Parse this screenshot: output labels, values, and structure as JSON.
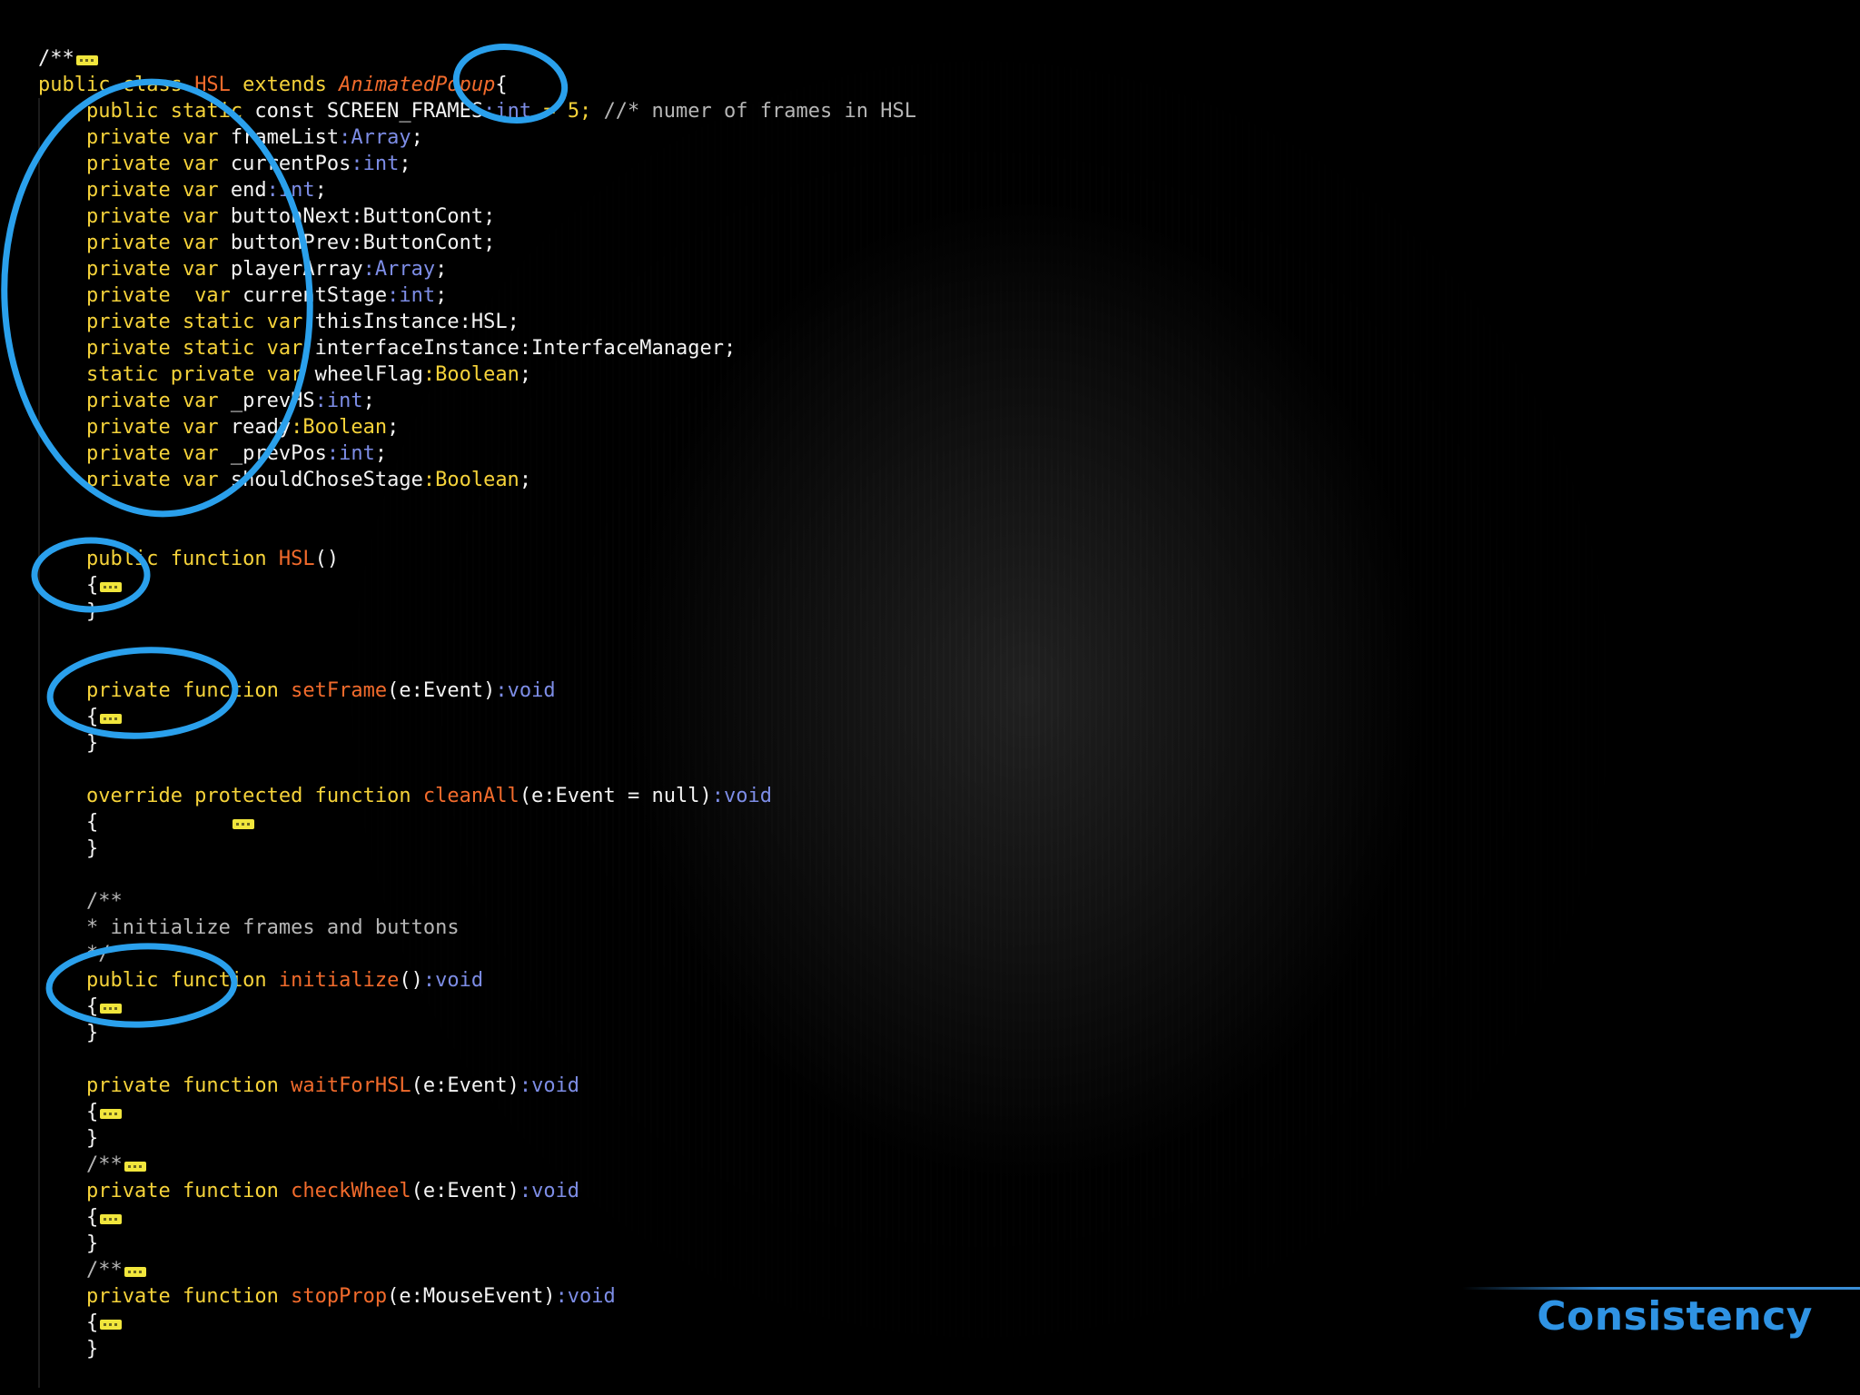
{
  "slide": {
    "title": "Consistency",
    "accent_color": "#2aa0ec"
  },
  "editor": {
    "language": "ActionScript",
    "fold_marker_icon": "collapsed-code-icon",
    "lines": [
      [
        {
          "t": "/**",
          "c": "txt"
        },
        {
          "fold": true
        }
      ],
      [
        {
          "t": "public class ",
          "c": "kw"
        },
        {
          "t": "HSL",
          "c": "cls"
        },
        {
          "t": " extends ",
          "c": "kw"
        },
        {
          "t": "AnimatedPopup",
          "c": "it"
        },
        {
          "t": "{",
          "c": "txt"
        }
      ],
      [
        {
          "t": "    public static ",
          "c": "kw"
        },
        {
          "t": "const SCREEN_FRAMES",
          "c": "txt"
        },
        {
          "t": ":int",
          "c": "type"
        },
        {
          "t": " = 5; ",
          "c": "kw"
        },
        {
          "t": "//* numer of frames in HSL",
          "c": "cm"
        }
      ],
      [
        {
          "t": "    private var ",
          "c": "kw"
        },
        {
          "t": "frameList",
          "c": "txt"
        },
        {
          "t": ":Array",
          "c": "type"
        },
        {
          "t": ";",
          "c": "txt"
        }
      ],
      [
        {
          "t": "    private var ",
          "c": "kw"
        },
        {
          "t": "currentPos",
          "c": "txt"
        },
        {
          "t": ":int",
          "c": "type"
        },
        {
          "t": ";",
          "c": "txt"
        }
      ],
      [
        {
          "t": "    private var ",
          "c": "kw"
        },
        {
          "t": "end",
          "c": "txt"
        },
        {
          "t": ":int",
          "c": "type"
        },
        {
          "t": ";",
          "c": "txt"
        }
      ],
      [
        {
          "t": "    private var ",
          "c": "kw"
        },
        {
          "t": "buttonNext:ButtonCont;",
          "c": "txt"
        }
      ],
      [
        {
          "t": "    private var ",
          "c": "kw"
        },
        {
          "t": "buttonPrev:ButtonCont;",
          "c": "txt"
        }
      ],
      [
        {
          "t": "    private var ",
          "c": "kw"
        },
        {
          "t": "playerArray",
          "c": "txt"
        },
        {
          "t": ":Array",
          "c": "type"
        },
        {
          "t": ";",
          "c": "txt"
        }
      ],
      [
        {
          "t": "    private  var ",
          "c": "kw"
        },
        {
          "t": "currentStage",
          "c": "txt"
        },
        {
          "t": ":int",
          "c": "type"
        },
        {
          "t": ";",
          "c": "txt"
        }
      ],
      [
        {
          "t": "    private static var ",
          "c": "kw"
        },
        {
          "t": "thisInstance:HSL;",
          "c": "txt"
        }
      ],
      [
        {
          "t": "    private static var ",
          "c": "kw"
        },
        {
          "t": "interfaceInstance:InterfaceManager;",
          "c": "txt"
        }
      ],
      [
        {
          "t": "    static private var ",
          "c": "kw"
        },
        {
          "t": "wheelFlag",
          "c": "txt"
        },
        {
          "t": ":Boolean",
          "c": "kw"
        },
        {
          "t": ";",
          "c": "txt"
        }
      ],
      [
        {
          "t": "    private var ",
          "c": "kw"
        },
        {
          "t": "_prevHS",
          "c": "txt"
        },
        {
          "t": ":int",
          "c": "type"
        },
        {
          "t": ";",
          "c": "txt"
        }
      ],
      [
        {
          "t": "    private var ",
          "c": "kw"
        },
        {
          "t": "ready",
          "c": "txt"
        },
        {
          "t": ":Boolean",
          "c": "kw"
        },
        {
          "t": ";",
          "c": "txt"
        }
      ],
      [
        {
          "t": "    private var ",
          "c": "kw"
        },
        {
          "t": "_prevPos",
          "c": "txt"
        },
        {
          "t": ":int",
          "c": "type"
        },
        {
          "t": ";",
          "c": "txt"
        }
      ],
      [
        {
          "t": "    private var ",
          "c": "kw"
        },
        {
          "t": "shouldChoseStage",
          "c": "txt"
        },
        {
          "t": ":Boolean",
          "c": "kw"
        },
        {
          "t": ";",
          "c": "txt"
        }
      ],
      [],
      [],
      [
        {
          "t": "    public function ",
          "c": "kw"
        },
        {
          "t": "HSL",
          "c": "fn"
        },
        {
          "t": "()",
          "c": "txt"
        }
      ],
      [
        {
          "t": "    {",
          "c": "txt"
        },
        {
          "fold": true
        }
      ],
      [
        {
          "t": "    }",
          "c": "txt"
        }
      ],
      [],
      [],
      [
        {
          "t": "    private function ",
          "c": "kw"
        },
        {
          "t": "setFrame",
          "c": "fn"
        },
        {
          "t": "(e:Event)",
          "c": "txt"
        },
        {
          "t": ":void",
          "c": "type"
        }
      ],
      [
        {
          "t": "    {",
          "c": "txt"
        },
        {
          "fold": true
        }
      ],
      [
        {
          "t": "    }",
          "c": "txt"
        }
      ],
      [],
      [
        {
          "t": "    override protected function ",
          "c": "kw"
        },
        {
          "t": "cleanAll",
          "c": "fn"
        },
        {
          "t": "(e:Event = null)",
          "c": "txt"
        },
        {
          "t": ":void",
          "c": "type"
        }
      ],
      [
        {
          "t": "    {           ",
          "c": "txt"
        },
        {
          "fold": true
        }
      ],
      [
        {
          "t": "    }",
          "c": "txt"
        }
      ],
      [],
      [
        {
          "t": "    /**",
          "c": "cm"
        }
      ],
      [
        {
          "t": "    * initialize frames and buttons",
          "c": "cm"
        }
      ],
      [
        {
          "t": "    */",
          "c": "cm"
        }
      ],
      [
        {
          "t": "    public function ",
          "c": "kw"
        },
        {
          "t": "initialize",
          "c": "fn"
        },
        {
          "t": "()",
          "c": "txt"
        },
        {
          "t": ":void",
          "c": "type"
        }
      ],
      [
        {
          "t": "    {",
          "c": "txt"
        },
        {
          "fold": true
        }
      ],
      [
        {
          "t": "    }",
          "c": "txt"
        }
      ],
      [],
      [
        {
          "t": "    private function ",
          "c": "kw"
        },
        {
          "t": "waitForHSL",
          "c": "fn"
        },
        {
          "t": "(e:Event)",
          "c": "txt"
        },
        {
          "t": ":void",
          "c": "type"
        }
      ],
      [
        {
          "t": "    {",
          "c": "txt"
        },
        {
          "fold": true
        }
      ],
      [
        {
          "t": "    }",
          "c": "txt"
        }
      ],
      [
        {
          "t": "    /**",
          "c": "cm"
        },
        {
          "fold": true
        }
      ],
      [
        {
          "t": "    private function ",
          "c": "kw"
        },
        {
          "t": "checkWheel",
          "c": "fn"
        },
        {
          "t": "(e:Event)",
          "c": "txt"
        },
        {
          "t": ":void",
          "c": "type"
        }
      ],
      [
        {
          "t": "    {",
          "c": "txt"
        },
        {
          "fold": true
        }
      ],
      [
        {
          "t": "    }",
          "c": "txt"
        }
      ],
      [
        {
          "t": "    /**",
          "c": "cm"
        },
        {
          "fold": true
        }
      ],
      [
        {
          "t": "    private function ",
          "c": "kw"
        },
        {
          "t": "stopProp",
          "c": "fn"
        },
        {
          "t": "(e:MouseEvent)",
          "c": "txt"
        },
        {
          "t": ":void",
          "c": "type"
        }
      ],
      [
        {
          "t": "    {",
          "c": "txt"
        },
        {
          "fold": true
        }
      ],
      [
        {
          "t": "    }",
          "c": "txt"
        }
      ]
    ]
  },
  "annotations": {
    "shape": "hand-drawn-ellipse",
    "count": 5
  }
}
